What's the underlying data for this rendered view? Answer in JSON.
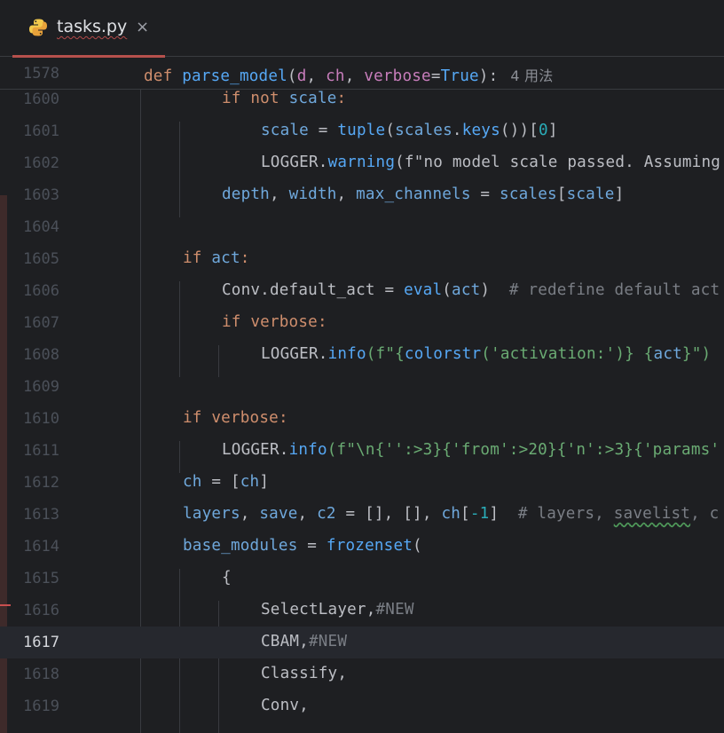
{
  "tab": {
    "file_name": "tasks.py",
    "close_glyph": "×",
    "icon": "python-icon"
  },
  "sticky": {
    "line_no": "1578",
    "kw": "def",
    "fn": "parse_model",
    "p1": "d",
    "p2": "ch",
    "p3": "verbose",
    "default": "True",
    "usages": "4 用法"
  },
  "lines": {
    "l1600": {
      "no": "1600",
      "a": "if",
      "b": "not",
      "c": "scale",
      "d": ":"
    },
    "l1601": {
      "no": "1601",
      "a": "scale",
      "b": " = ",
      "c": "tuple",
      "d": "(",
      "e": "scales",
      "f": ".",
      "g": "keys",
      "h": "())[",
      "i": "0",
      "j": "]"
    },
    "l1602": {
      "no": "1602",
      "a": "LOGGER",
      "b": ".",
      "c": "warning",
      "d": "(f\"no model scale passed. Assuming"
    },
    "l1603": {
      "no": "1603",
      "a": "depth",
      "b": ", ",
      "c": "width",
      "d": ", ",
      "e": "max_channels",
      "f": " = ",
      "g": "scales",
      "h": "[",
      "i": "scale",
      "j": "]"
    },
    "l1604": {
      "no": "1604"
    },
    "l1605": {
      "no": "1605",
      "a": "if",
      "b": "act",
      "c": ":"
    },
    "l1606": {
      "no": "1606",
      "a": "Conv",
      "b": ".default_act = ",
      "c": "eval",
      "d": "(",
      "e": "act",
      "f": ")  ",
      "g": "# redefine default act"
    },
    "l1607": {
      "no": "1607",
      "a": "if",
      "b": "verbose",
      "c": ":"
    },
    "l1608": {
      "no": "1608",
      "a": "LOGGER",
      "b": ".",
      "c": "info",
      "d": "(f\"{",
      "e": "colorstr",
      "f": "('activation:')",
      "g": "} {",
      "h": "act",
      "i": "}\")"
    },
    "l1609": {
      "no": "1609"
    },
    "l1610": {
      "no": "1610",
      "a": "if",
      "b": "verbose",
      "c": ":"
    },
    "l1611": {
      "no": "1611",
      "a": "LOGGER",
      "b": ".",
      "c": "info",
      "d": "(f\"\\n{'':>3}{'from':>20}{'n':>3}{'params'"
    },
    "l1612": {
      "no": "1612",
      "a": "ch",
      "b": " = [",
      "c": "ch",
      "d": "]"
    },
    "l1613": {
      "no": "1613",
      "a": "layers",
      "b": ", ",
      "c": "save",
      "d": ", ",
      "e": "c2",
      "f": " = [], [], ",
      "g": "ch",
      "h": "[",
      "i": "-1",
      "j": "]  ",
      "k": "# layers, ",
      "l": "savelist",
      "m": ", c"
    },
    "l1614": {
      "no": "1614",
      "a": "base_modules",
      "b": " = ",
      "c": "frozenset",
      "d": "("
    },
    "l1615": {
      "no": "1615",
      "a": "{"
    },
    "l1616": {
      "no": "1616",
      "a": "SelectLayer",
      "b": ",",
      "c": "#NEW"
    },
    "l1617": {
      "no": "1617",
      "a": "CBAM",
      "b": ",",
      "c": "#NEW"
    },
    "l1618": {
      "no": "1618",
      "a": "Classify",
      "b": ","
    },
    "l1619": {
      "no": "1619",
      "a": "Conv",
      "b": ","
    }
  },
  "colors": {
    "background": "#1e1f22",
    "current_line": "#26282e",
    "keyword": "#cf8e6d",
    "function": "#56a8f5",
    "parameter": "#c77dbb",
    "string": "#6aab73",
    "number": "#2aacb8",
    "comment": "#7a7e85",
    "tab_underline": "#b6504c"
  }
}
